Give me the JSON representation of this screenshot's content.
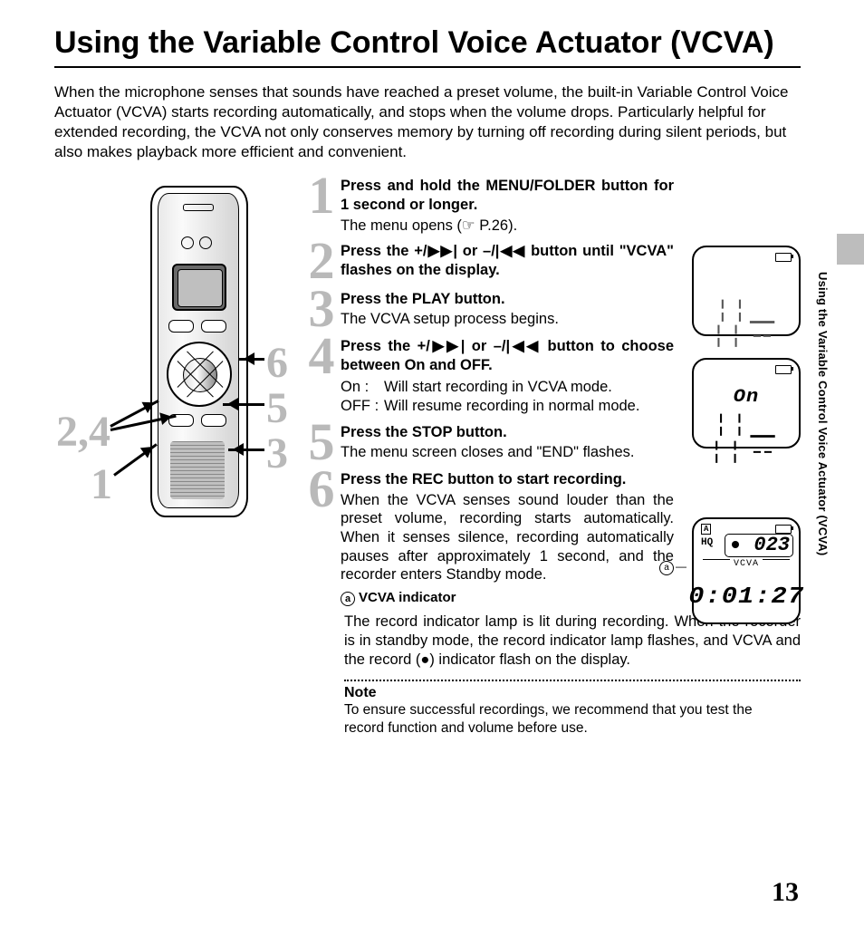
{
  "title": "Using the Variable Control Voice Actuator (VCVA)",
  "side_tab_text": "Using the Variable Control Voice Actuator (VCVA)",
  "intro": "When the microphone senses that sounds have reached a preset volume, the built-in Variable Control Voice Actuator (VCVA) starts recording automatically, and stops when the volume drops. Particularly helpful for extended recording, the VCVA not only conserves memory by turning off recording during silent periods, but also makes playback more efficient and convenient.",
  "callouts": {
    "left_upper": "2,4",
    "left_lower": "1",
    "right_upper": "6",
    "right_mid": "5",
    "right_lower": "3"
  },
  "steps": [
    {
      "n": "1",
      "head_pre": "Press and hold the ",
      "head_btn": "MENU/FOLDER",
      "head_post": " button for 1 second or longer.",
      "detail": "The menu opens (☞ P.26)."
    },
    {
      "n": "2",
      "head_pre": "Press the ",
      "head_btn": "+/▶▶| or –/|◀◀",
      "head_post": " button until \"VCVA\" flashes on the display.",
      "detail": ""
    },
    {
      "n": "3",
      "head_pre": "Press the ",
      "head_btn": "PLAY",
      "head_post": " button.",
      "detail": "The VCVA setup process begins."
    },
    {
      "n": "4",
      "head_pre": "Press the ",
      "head_btn": "+/▶▶| or –/|◀◀",
      "head_post": " button to choose between On and OFF.",
      "detail": "",
      "defs": [
        {
          "k": "On",
          "sep": ":",
          "v": "Will start recording in VCVA mode."
        },
        {
          "k": "OFF",
          "sep": ":",
          "v": "Will resume recording in normal mode."
        }
      ]
    },
    {
      "n": "5",
      "head_pre": "Press the ",
      "head_btn": "STOP",
      "head_post": " button.",
      "detail": "The menu screen closes and \"END\" flashes."
    },
    {
      "n": "6",
      "head_pre": "Press the ",
      "head_btn": "REC",
      "head_post": " button to start recording.",
      "detail": "When the VCVA senses sound louder than the preset volume, recording starts automatically. When it senses silence, recording automatically pauses after approximately 1 second, and the recorder enters Standby mode.",
      "indicator": "VCVA indicator"
    }
  ],
  "tail": "The record indicator lamp is lit during recording. When the recorder is in standby mode, the record indicator lamp flashes, and VCVA and the record (●) indicator flash on the display.",
  "note_head": "Note",
  "note_body": "To ensure successful recordings, we recommend that you test the record function and volume before use.",
  "page_number": "13",
  "lcd": {
    "screen1_text": "╎╎╴ ╎╎╶╴",
    "screen1_alt": "VCVA",
    "screen2_row1": "On",
    "screen2_row2": "VC VA",
    "screen3": {
      "folder": "A",
      "mode": "HQ",
      "file": "023",
      "vcva": "VCVA",
      "time": "0:01:27",
      "label": "a"
    }
  }
}
